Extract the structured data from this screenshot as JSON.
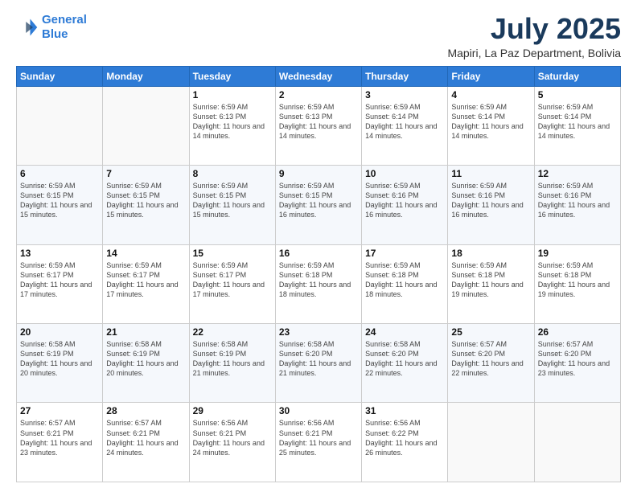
{
  "logo": {
    "line1": "General",
    "line2": "Blue"
  },
  "header": {
    "month": "July 2025",
    "location": "Mapiri, La Paz Department, Bolivia"
  },
  "weekdays": [
    "Sunday",
    "Monday",
    "Tuesday",
    "Wednesday",
    "Thursday",
    "Friday",
    "Saturday"
  ],
  "weeks": [
    [
      {
        "day": "",
        "text": ""
      },
      {
        "day": "",
        "text": ""
      },
      {
        "day": "1",
        "text": "Sunrise: 6:59 AM\nSunset: 6:13 PM\nDaylight: 11 hours and 14 minutes."
      },
      {
        "day": "2",
        "text": "Sunrise: 6:59 AM\nSunset: 6:13 PM\nDaylight: 11 hours and 14 minutes."
      },
      {
        "day": "3",
        "text": "Sunrise: 6:59 AM\nSunset: 6:14 PM\nDaylight: 11 hours and 14 minutes."
      },
      {
        "day": "4",
        "text": "Sunrise: 6:59 AM\nSunset: 6:14 PM\nDaylight: 11 hours and 14 minutes."
      },
      {
        "day": "5",
        "text": "Sunrise: 6:59 AM\nSunset: 6:14 PM\nDaylight: 11 hours and 14 minutes."
      }
    ],
    [
      {
        "day": "6",
        "text": "Sunrise: 6:59 AM\nSunset: 6:15 PM\nDaylight: 11 hours and 15 minutes."
      },
      {
        "day": "7",
        "text": "Sunrise: 6:59 AM\nSunset: 6:15 PM\nDaylight: 11 hours and 15 minutes."
      },
      {
        "day": "8",
        "text": "Sunrise: 6:59 AM\nSunset: 6:15 PM\nDaylight: 11 hours and 15 minutes."
      },
      {
        "day": "9",
        "text": "Sunrise: 6:59 AM\nSunset: 6:15 PM\nDaylight: 11 hours and 16 minutes."
      },
      {
        "day": "10",
        "text": "Sunrise: 6:59 AM\nSunset: 6:16 PM\nDaylight: 11 hours and 16 minutes."
      },
      {
        "day": "11",
        "text": "Sunrise: 6:59 AM\nSunset: 6:16 PM\nDaylight: 11 hours and 16 minutes."
      },
      {
        "day": "12",
        "text": "Sunrise: 6:59 AM\nSunset: 6:16 PM\nDaylight: 11 hours and 16 minutes."
      }
    ],
    [
      {
        "day": "13",
        "text": "Sunrise: 6:59 AM\nSunset: 6:17 PM\nDaylight: 11 hours and 17 minutes."
      },
      {
        "day": "14",
        "text": "Sunrise: 6:59 AM\nSunset: 6:17 PM\nDaylight: 11 hours and 17 minutes."
      },
      {
        "day": "15",
        "text": "Sunrise: 6:59 AM\nSunset: 6:17 PM\nDaylight: 11 hours and 17 minutes."
      },
      {
        "day": "16",
        "text": "Sunrise: 6:59 AM\nSunset: 6:18 PM\nDaylight: 11 hours and 18 minutes."
      },
      {
        "day": "17",
        "text": "Sunrise: 6:59 AM\nSunset: 6:18 PM\nDaylight: 11 hours and 18 minutes."
      },
      {
        "day": "18",
        "text": "Sunrise: 6:59 AM\nSunset: 6:18 PM\nDaylight: 11 hours and 19 minutes."
      },
      {
        "day": "19",
        "text": "Sunrise: 6:59 AM\nSunset: 6:18 PM\nDaylight: 11 hours and 19 minutes."
      }
    ],
    [
      {
        "day": "20",
        "text": "Sunrise: 6:58 AM\nSunset: 6:19 PM\nDaylight: 11 hours and 20 minutes."
      },
      {
        "day": "21",
        "text": "Sunrise: 6:58 AM\nSunset: 6:19 PM\nDaylight: 11 hours and 20 minutes."
      },
      {
        "day": "22",
        "text": "Sunrise: 6:58 AM\nSunset: 6:19 PM\nDaylight: 11 hours and 21 minutes."
      },
      {
        "day": "23",
        "text": "Sunrise: 6:58 AM\nSunset: 6:20 PM\nDaylight: 11 hours and 21 minutes."
      },
      {
        "day": "24",
        "text": "Sunrise: 6:58 AM\nSunset: 6:20 PM\nDaylight: 11 hours and 22 minutes."
      },
      {
        "day": "25",
        "text": "Sunrise: 6:57 AM\nSunset: 6:20 PM\nDaylight: 11 hours and 22 minutes."
      },
      {
        "day": "26",
        "text": "Sunrise: 6:57 AM\nSunset: 6:20 PM\nDaylight: 11 hours and 23 minutes."
      }
    ],
    [
      {
        "day": "27",
        "text": "Sunrise: 6:57 AM\nSunset: 6:21 PM\nDaylight: 11 hours and 23 minutes."
      },
      {
        "day": "28",
        "text": "Sunrise: 6:57 AM\nSunset: 6:21 PM\nDaylight: 11 hours and 24 minutes."
      },
      {
        "day": "29",
        "text": "Sunrise: 6:56 AM\nSunset: 6:21 PM\nDaylight: 11 hours and 24 minutes."
      },
      {
        "day": "30",
        "text": "Sunrise: 6:56 AM\nSunset: 6:21 PM\nDaylight: 11 hours and 25 minutes."
      },
      {
        "day": "31",
        "text": "Sunrise: 6:56 AM\nSunset: 6:22 PM\nDaylight: 11 hours and 26 minutes."
      },
      {
        "day": "",
        "text": ""
      },
      {
        "day": "",
        "text": ""
      }
    ]
  ]
}
